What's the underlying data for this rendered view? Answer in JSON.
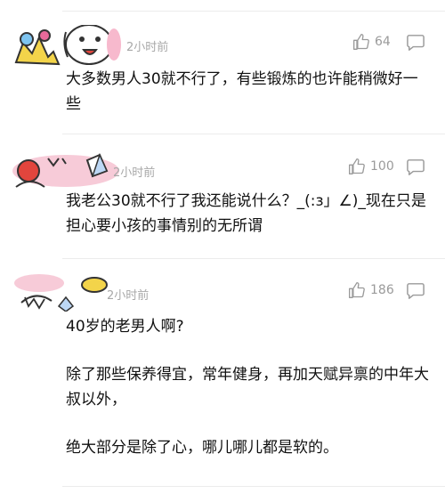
{
  "comments": [
    {
      "time": "2小时前",
      "likes": "64",
      "paragraphs": [
        "大多数男人30就不行了，有些锻炼的也许能稍微好一些"
      ]
    },
    {
      "time": "2小时前",
      "likes": "100",
      "paragraphs": [
        "我老公30就不行了我还能说什么？_(:з」∠)_现在只是担心要小孩的事情别的无所谓"
      ]
    },
    {
      "time": "2小时前",
      "likes": "186",
      "paragraphs": [
        "40岁的老男人啊?",
        "除了那些保养得宜，常年健身，再加天赋异禀的中年大叔以外，",
        "绝大部分是除了心，哪儿哪儿都是软的。"
      ]
    }
  ],
  "icons": {
    "like": "thumbs-up-icon",
    "reply": "comment-bubble-icon"
  }
}
